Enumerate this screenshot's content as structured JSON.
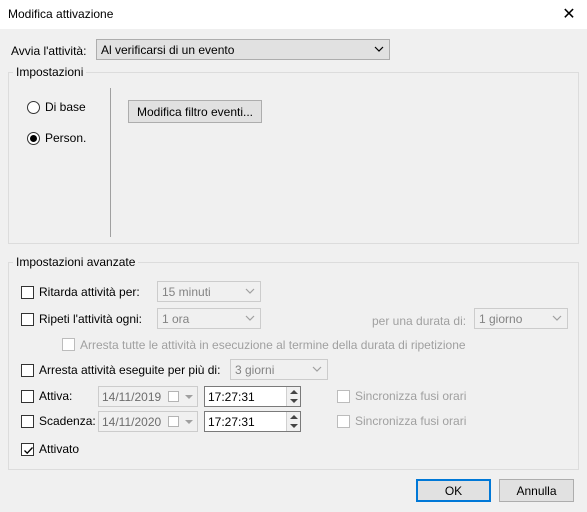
{
  "window": {
    "title": "Modifica attivazione",
    "close_icon": "close-icon"
  },
  "trigger": {
    "label": "Avvia l'attività:",
    "value": "Al verificarsi di un evento"
  },
  "settings": {
    "title": "Impostazioni",
    "basic_label": "Di base",
    "custom_label": "Person.",
    "selected": "Person.",
    "edit_filter_button": "Modifica filtro eventi..."
  },
  "advanced": {
    "title": "Impostazioni avanzate",
    "delay": {
      "label": "Ritarda attività per:",
      "checked": false,
      "value": "15 minuti"
    },
    "repeat": {
      "label": "Ripeti l'attività ogni:",
      "checked": false,
      "value": "1 ora",
      "duration_label": "per una durata di:",
      "duration_value": "1 giorno",
      "stop_all_label": "Arresta tutte le attività in esecuzione al termine della durata di ripetizione"
    },
    "stop_longer": {
      "label": "Arresta attività eseguite per più di:",
      "checked": false,
      "value": "3 giorni"
    },
    "activate": {
      "label": "Attiva:",
      "checked": false,
      "date": "14/11/2019",
      "time": "17:27:31",
      "sync_label": "Sincronizza fusi orari"
    },
    "expire": {
      "label": "Scadenza:",
      "checked": false,
      "date": "14/11/2020",
      "time": "17:27:31",
      "sync_label": "Sincronizza fusi orari"
    },
    "enabled": {
      "label": "Attivato",
      "checked": true
    }
  },
  "buttons": {
    "ok": "OK",
    "cancel": "Annulla"
  },
  "colors": {
    "accent": "#0078d7",
    "background": "#f0f0f0",
    "disabled_text": "#a0a0a0"
  }
}
